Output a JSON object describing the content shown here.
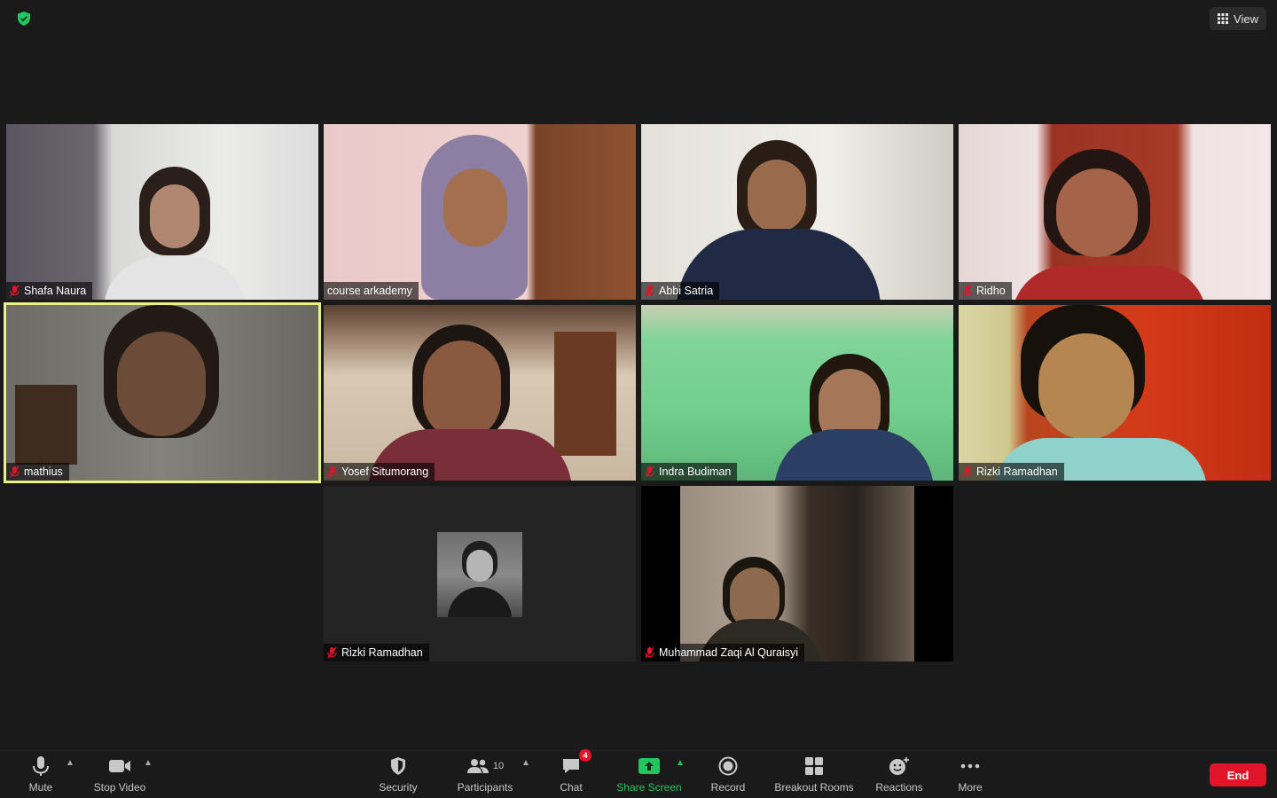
{
  "top": {
    "view_label": "View"
  },
  "tiles": [
    {
      "name": "Shafa Naura",
      "muted": true
    },
    {
      "name": "course arkademy",
      "muted": false
    },
    {
      "name": "Abbi Satria",
      "muted": true
    },
    {
      "name": "Ridho",
      "muted": true
    },
    {
      "name": "mathius",
      "muted": true,
      "active_speaker": true
    },
    {
      "name": "Yosef Situmorang",
      "muted": true
    },
    {
      "name": "Indra Budiman",
      "muted": true
    },
    {
      "name": "Rizki Ramadhan",
      "muted": true
    },
    {
      "name": "Rizki Ramadhan",
      "muted": true,
      "video_off": true
    },
    {
      "name": "Muhammad Zaqi Al Quraisyi",
      "muted": true
    }
  ],
  "toolbar": {
    "mute_label": "Mute",
    "stop_video_label": "Stop Video",
    "security_label": "Security",
    "participants_label": "Participants",
    "participants_count": "10",
    "chat_label": "Chat",
    "chat_badge": "4",
    "share_screen_label": "Share Screen",
    "record_label": "Record",
    "breakout_rooms_label": "Breakout Rooms",
    "reactions_label": "Reactions",
    "more_label": "More",
    "end_label": "End"
  },
  "colors": {
    "background": "#1a1a1a",
    "active_speaker_border": "#e9f18a",
    "share_green": "#22c55e",
    "end_red": "#e0152a",
    "muted_red": "#e0152a"
  }
}
